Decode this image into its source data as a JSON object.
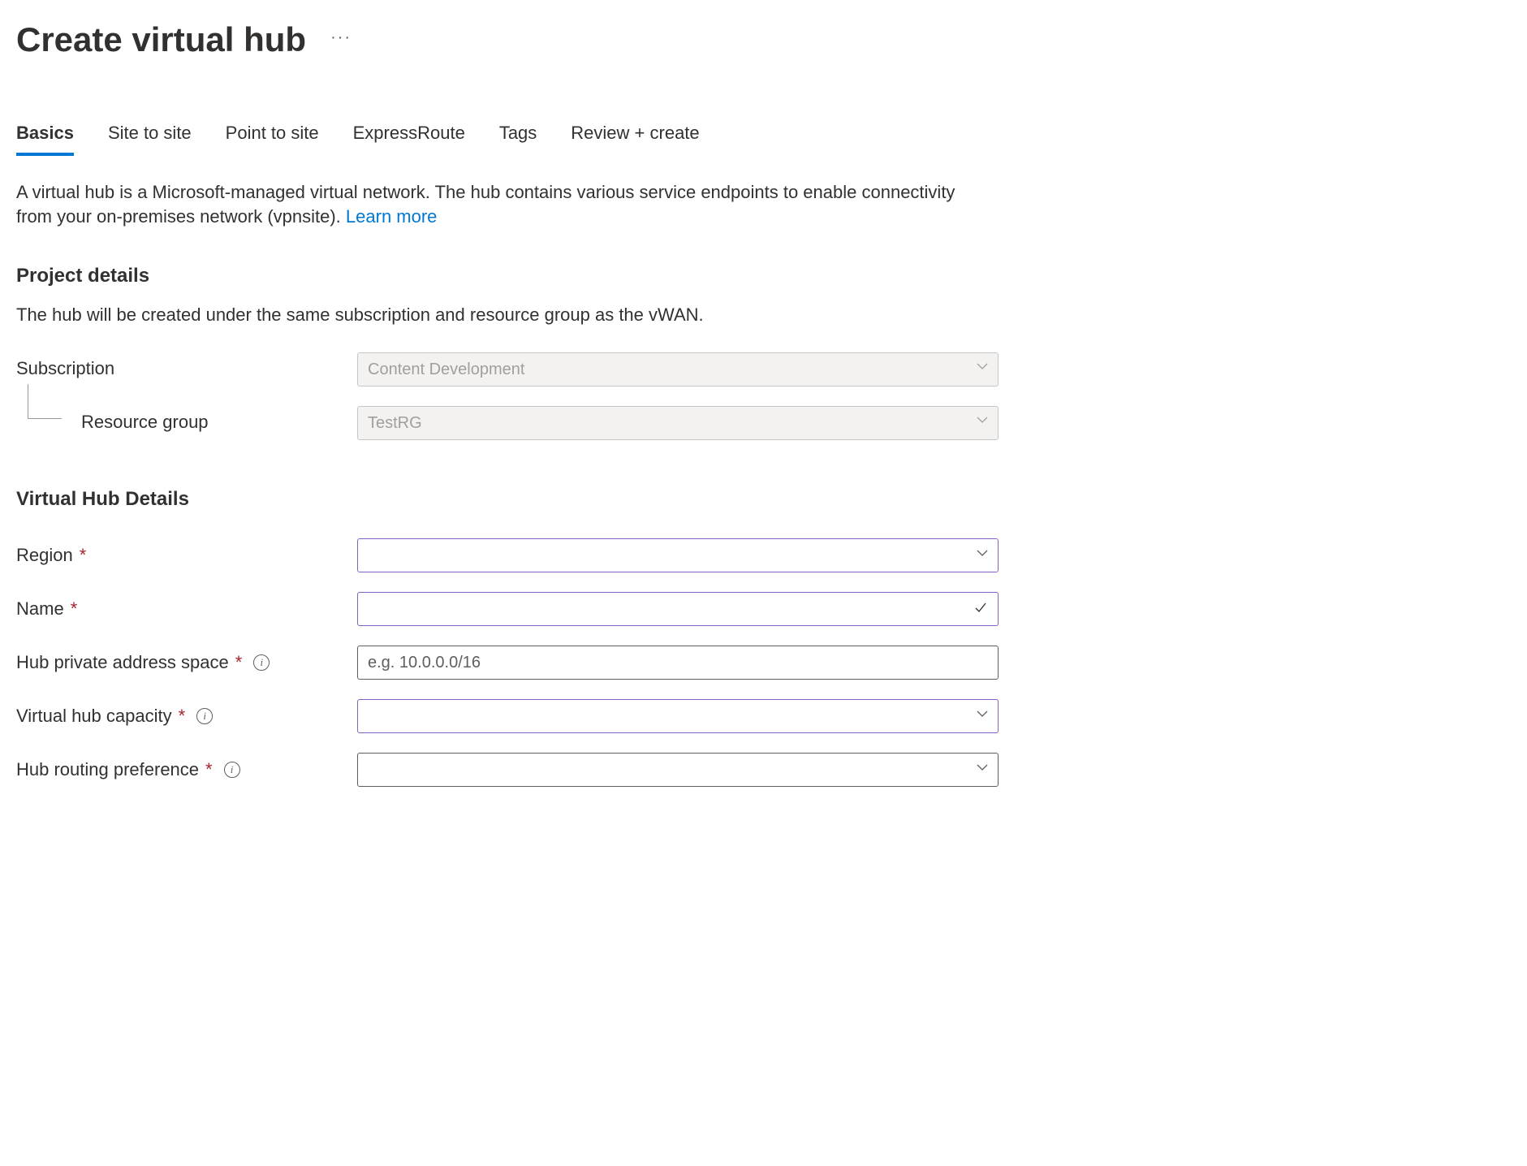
{
  "header": {
    "title": "Create virtual hub"
  },
  "tabs": {
    "basics": "Basics",
    "site_to_site": "Site to site",
    "point_to_site": "Point to site",
    "expressroute": "ExpressRoute",
    "tags": "Tags",
    "review_create": "Review + create"
  },
  "description": {
    "text": "A virtual hub is a Microsoft-managed virtual network. The hub contains various service endpoints to enable connectivity from your on-premises network (vpnsite). ",
    "link_text": "Learn more"
  },
  "project_details": {
    "heading": "Project details",
    "subtext": "The hub will be created under the same subscription and resource group as the vWAN.",
    "subscription_label": "Subscription",
    "subscription_value": "Content Development",
    "resource_group_label": "Resource group",
    "resource_group_value": "TestRG"
  },
  "vhub_details": {
    "heading": "Virtual Hub Details",
    "region_label": "Region",
    "region_value": "",
    "name_label": "Name",
    "name_value": "",
    "addr_label": "Hub private address space",
    "addr_placeholder": "e.g. 10.0.0.0/16",
    "addr_value": "",
    "capacity_label": "Virtual hub capacity",
    "capacity_value": "",
    "routing_label": "Hub routing preference",
    "routing_value": ""
  }
}
